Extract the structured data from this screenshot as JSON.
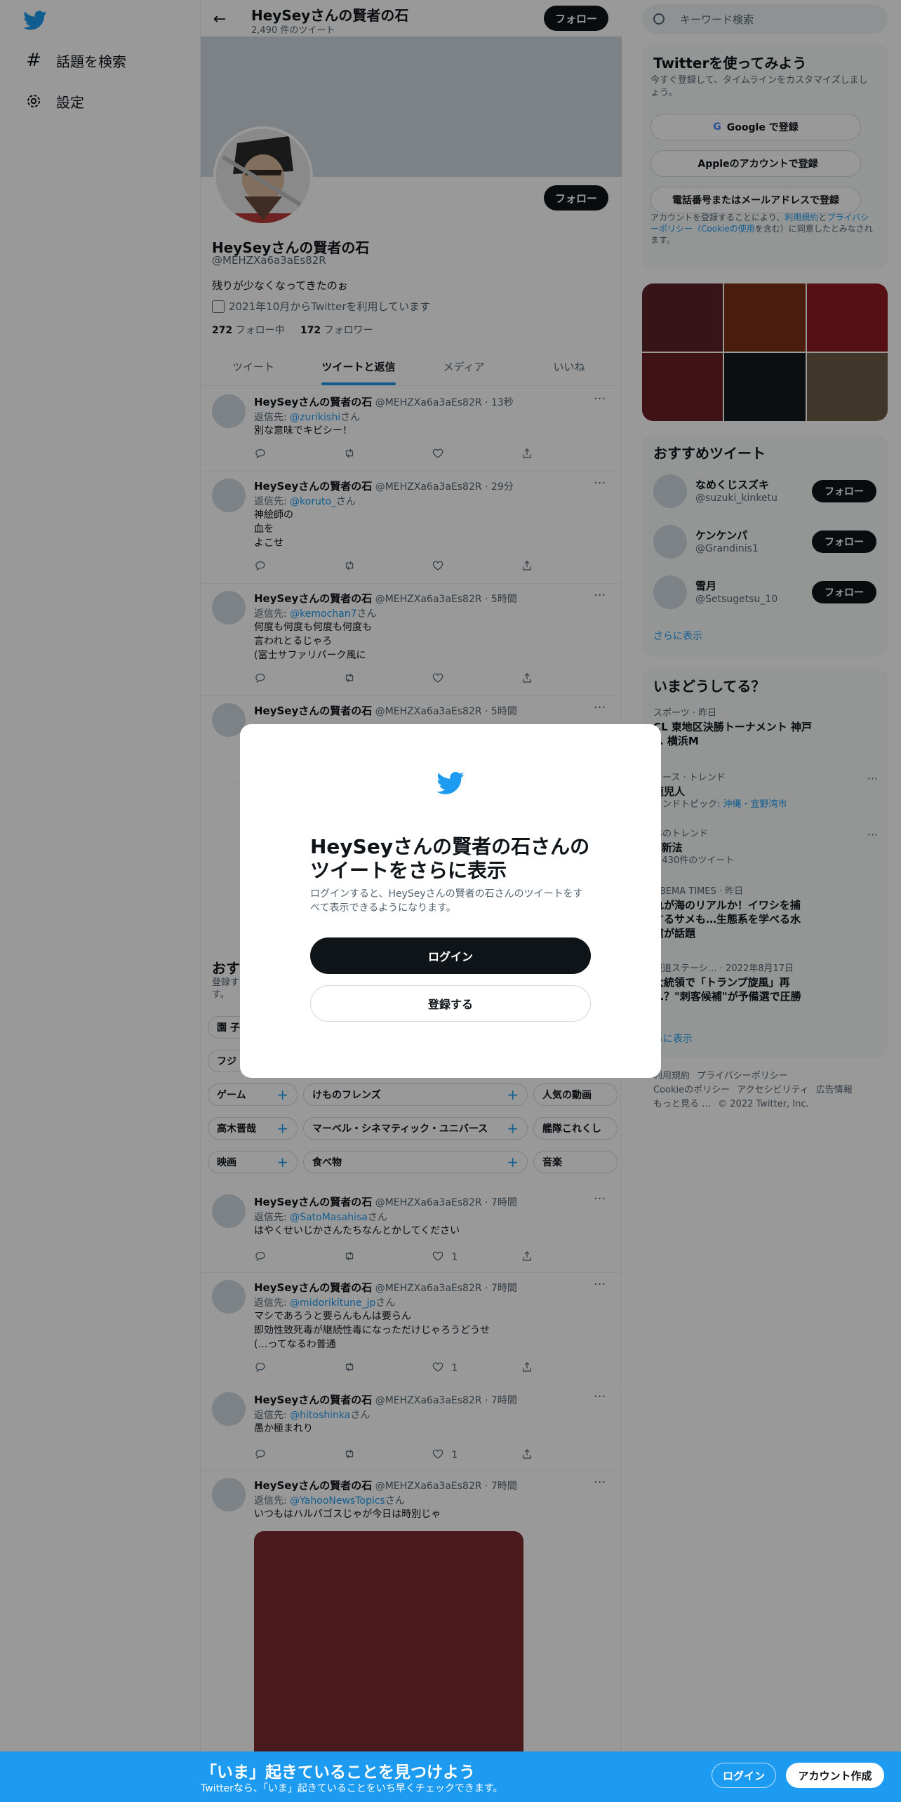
{
  "nav": {
    "explore_label": "話題を検索",
    "settings_label": "設定"
  },
  "header": {
    "name": "HeySeyさんの賢者の石",
    "tweet_count": "2,490 件のツイート",
    "follow_label": "フォロー"
  },
  "profile": {
    "name": "HeySeyさんの賢者の石",
    "handle": "@MEHZXa6a3aEs82R",
    "bio": "残りが少なくなってきたのぉ",
    "joined": "2021年10月からTwitterを利用しています",
    "following_count": "272",
    "following_label": "フォロー中",
    "followers_count": "172",
    "followers_label": "フォロワー",
    "follow_label": "フォロー"
  },
  "tabs": [
    {
      "label": "ツイート"
    },
    {
      "label": "ツイートと返信"
    },
    {
      "label": "メディア"
    },
    {
      "label": "いいね"
    }
  ],
  "tweets": [
    {
      "name": "HeySeyさんの賢者の石",
      "meta": "@MEHZXa6a3aEs82R · 13秒",
      "reply_prefix": "返信先:",
      "reply_to": "@zurikishi",
      "reply_suffix": "さん",
      "text": "別な意味でキビシー！",
      "likes": ""
    },
    {
      "name": "HeySeyさんの賢者の石",
      "meta": "@MEHZXa6a3aEs82R · 29分",
      "reply_prefix": "返信先:",
      "reply_to": "@koruto_",
      "reply_suffix": "さん",
      "text": "神絵師の\n血を\nよこせ",
      "likes": ""
    },
    {
      "name": "HeySeyさんの賢者の石",
      "meta": "@MEHZXa6a3aEs82R · 5時間",
      "reply_prefix": "返信先:",
      "reply_to": "@kemochan7",
      "reply_suffix": "さん",
      "text": "何度も何度も何度も何度も\n言われとるじゃろ\n(富士サファリパーク風に",
      "likes": ""
    },
    {
      "name": "HeySeyさんの賢者の石",
      "meta": "@MEHZXa6a3aEs82R · 5時間",
      "reply_prefix": "",
      "reply_to": "",
      "reply_suffix": "",
      "text": "",
      "likes": ""
    },
    {
      "name": "HeySeyさんの賢者の石",
      "meta": "@MEHZXa6a3aEs82R · 7時間",
      "reply_prefix": "返信先:",
      "reply_to": "@SatoMasahisa",
      "reply_suffix": "さん",
      "text": "はやくせいじかさんたちなんとかしてください",
      "likes": "1"
    },
    {
      "name": "HeySeyさんの賢者の石",
      "meta": "@MEHZXa6a3aEs82R · 7時間",
      "reply_prefix": "返信先:",
      "reply_to": "@midorikitune_jp",
      "reply_suffix": "さん",
      "text": "マシであろうと要らんもんは要らん\n即効性致死毒が継続性毒になっただけじゃろうどうせ\n(…ってなるわ普通",
      "likes": "1"
    },
    {
      "name": "HeySeyさんの賢者の石",
      "meta": "@MEHZXa6a3aEs82R · 7時間",
      "reply_prefix": "返信先:",
      "reply_to": "@hitoshinka",
      "reply_suffix": "さん",
      "text": "愚か極まれり",
      "likes": "1"
    },
    {
      "name": "HeySeyさんの賢者の石",
      "meta": "@MEHZXa6a3aEs82R · 7時間",
      "reply_prefix": "返信先:",
      "reply_to": "@YahooNewsTopics",
      "reply_suffix": "さん",
      "text": "いつもはハルパゴスじゃが今日は時別じゃ",
      "likes": ""
    }
  ],
  "topics": {
    "title": "おす",
    "subtitle": "登録す\nす。",
    "rows": [
      [
        {
          "label": "園 子"
        }
      ],
      [
        {
          "label": "フジ"
        }
      ],
      [
        {
          "label": "ゲーム"
        },
        {
          "label": "けものフレンズ"
        },
        {
          "label": "人気の動画"
        }
      ],
      [
        {
          "label": "高木晋哉"
        },
        {
          "label": "マーベル・シネマティック・ユニバース"
        },
        {
          "label": "艦隊これくし"
        }
      ],
      [
        {
          "label": "映画"
        },
        {
          "label": "食べ物"
        },
        {
          "label": "音楽"
        }
      ]
    ]
  },
  "search": {
    "placeholder": "キーワード検索"
  },
  "signup": {
    "title": "Twitterを使ってみよう",
    "subtitle": "今すぐ登録して、タイムラインをカスタマイズしましょう。",
    "google": "Google で登録",
    "apple": "Appleのアカウントで登録",
    "phone": "電話番号またはメールアドレスで登録",
    "terms_prefix": "アカウントを登録することにより、",
    "terms_link1": "利用規約",
    "terms_mid": "と",
    "terms_link2": "プライバシーポリシー（Cookieの使用",
    "terms_suffix": "を含む）に同意したとみなされます。"
  },
  "media_colors": [
    "#5b2228",
    "#7a2f18",
    "#8c1c20",
    "#6a1f24",
    "#141a1f",
    "#6b5a45"
  ],
  "recommend": {
    "title": "おすすめツイート",
    "users": [
      {
        "name": "なめくじスズキ",
        "handle": "@suzuki_kinketu",
        "follow": "フォロー"
      },
      {
        "name": "ケンケンパ",
        "handle": "@Grandinis1",
        "follow": "フォロー"
      },
      {
        "name": "雪月",
        "handle": "@Setsugetsu_10",
        "follow": "フォロー"
      }
    ],
    "more": "さらに表示"
  },
  "trends": {
    "title": "いまどうしてる？",
    "items": [
      {
        "meta": "スポーツ · 昨日",
        "main": "CL 東地区決勝トーナメント 神戸\ns. 横浜M",
        "sub": ""
      },
      {
        "meta": "ュース · トレンド",
        "main": "鹿児人",
        "sub": "レンドトピック: ",
        "sub_links": "沖縄・宜野湾市"
      },
      {
        "meta": "本のトレンド",
        "main": "V新法",
        "sub": "5,430件のツイート"
      },
      {
        "meta": "ABEMA TIMES · 昨日",
        "main": "れが海のリアルか！イワシを捕\nするサメも…生態系を学べる水\n館が話題",
        "sub": ""
      },
      {
        "meta": "報道ステーシ… · 2022年8月17日",
        "main": "大統領で「トランプ旋風」再\n…？\"刺客候補\"が予備選で圧勝",
        "sub": ""
      }
    ],
    "more": "らに表示"
  },
  "footer": {
    "links": [
      "利用規約",
      "プライバシーポリシー",
      "Cookieのポリシー",
      "アクセシビリティ",
      "広告情報",
      "もっと見る …",
      "© 2022 Twitter, Inc."
    ]
  },
  "modal": {
    "title": "HeySeyさんの賢者の石さんのツイートをさらに表示",
    "subtitle": "ログインすると、HeySeyさんの賢者の石さんのツイートをすべて表示できるようになります。",
    "login": "ログイン",
    "signup": "登録する"
  },
  "bottom_bar": {
    "title": "「いま」起きていることを見つけよう",
    "subtitle": "Twitterなら、「いま」起きていることをいち早くチェックできます。",
    "login": "ログイン",
    "signup": "アカウント作成"
  },
  "colors": {
    "accent": "#1d9bf0",
    "dark": "#0f1419",
    "muted": "#536471"
  }
}
